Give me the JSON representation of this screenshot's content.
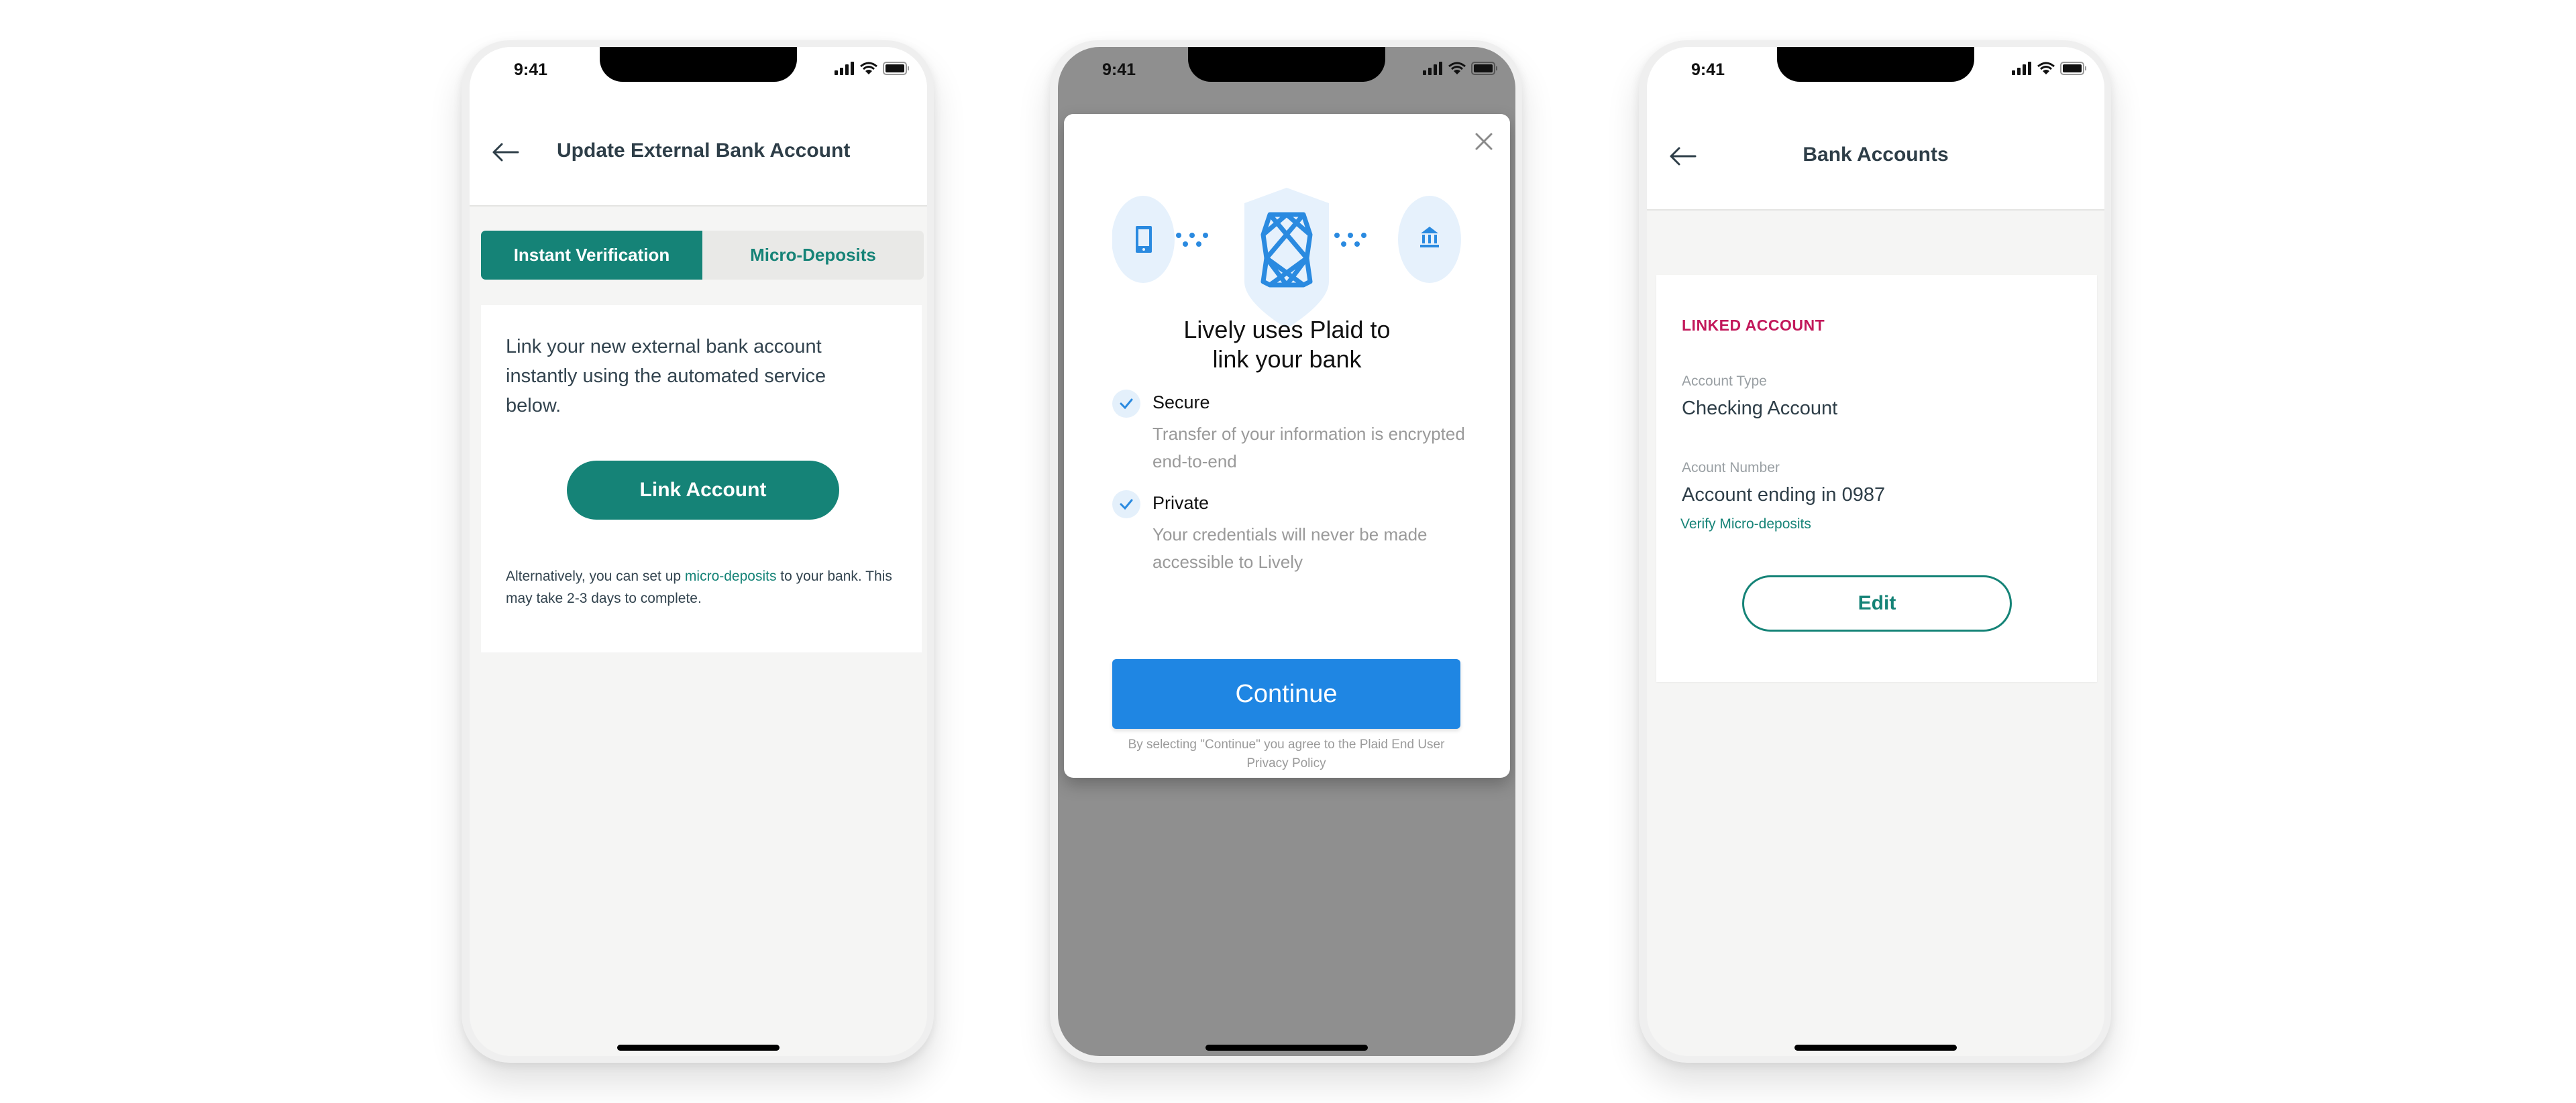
{
  "status_bar": {
    "time": "9:41"
  },
  "screen1": {
    "title": "Update External Bank Account",
    "tabs": [
      {
        "label": "Instant Verification",
        "active": true
      },
      {
        "label": "Micro-Deposits",
        "active": false
      }
    ],
    "description": "Link your new external bank account instantly using the automated service below.",
    "link_button": "Link Account",
    "alt_text_before": "Alternatively, you can set up ",
    "alt_link": "micro-deposits",
    "alt_text_after": " to your bank. This may take 2-3 days to complete."
  },
  "screen2": {
    "title": "Lively uses Plaid to link your bank",
    "features": [
      {
        "title": "Secure",
        "description": "Transfer of your information is encrypted end-to-end"
      },
      {
        "title": "Private",
        "description": "Your credentials will never be made accessible to Lively"
      }
    ],
    "continue_button": "Continue",
    "legal": "By selecting \"Continue\" you agree to the Plaid End User Privacy Policy"
  },
  "screen3": {
    "title": "Bank Accounts",
    "section_label": "LINKED ACCOUNT",
    "account_type_label": "Account Type",
    "account_type_value": "Checking Account",
    "account_number_label": "Acount Number",
    "account_number_value": "Account ending in 0987",
    "verify_link": "Verify Micro-deposits",
    "edit_button": "Edit"
  },
  "colors": {
    "brand_teal": "#158377",
    "plaid_blue": "#1f86e3",
    "linked_label": "#c2185b",
    "overlay": "#8f8f8f"
  }
}
